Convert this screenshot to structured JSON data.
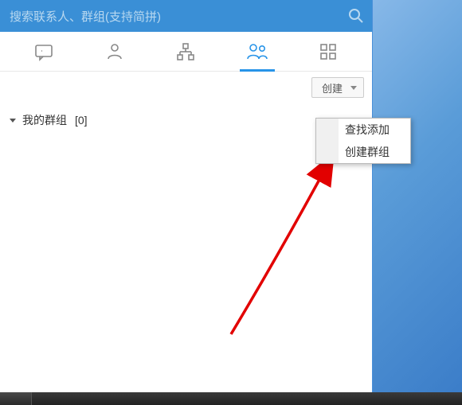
{
  "search": {
    "placeholder": "搜索联系人、群组(支持简拼)"
  },
  "tabs": {
    "messages": "messages",
    "contacts": "contacts",
    "org": "organization",
    "groups": "groups",
    "apps": "apps"
  },
  "toolbar": {
    "create_label": "创建"
  },
  "groups": {
    "my_groups_label": "我的群组",
    "my_groups_count": "[0]"
  },
  "dropdown": {
    "items": [
      {
        "label": "查找添加"
      },
      {
        "label": "创建群组"
      }
    ]
  }
}
